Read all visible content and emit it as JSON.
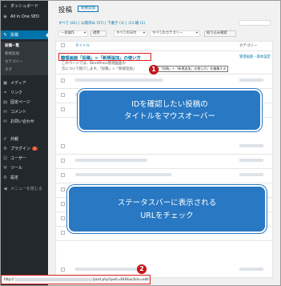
{
  "sidebar": {
    "items": [
      {
        "icon": "dashboard-icon",
        "glyph": "⌂",
        "label": "ダッシュボード"
      },
      {
        "icon": "seo-icon",
        "glyph": "◉",
        "label": "All in One SEO"
      },
      {
        "icon": "pin-icon",
        "glyph": "✎",
        "label": "投稿",
        "active": true
      },
      {
        "icon": "media-icon",
        "glyph": "▣",
        "label": "メディア"
      },
      {
        "icon": "link-icon",
        "glyph": "⚭",
        "label": "リンク"
      },
      {
        "icon": "page-icon",
        "glyph": "▤",
        "label": "固定ページ"
      },
      {
        "icon": "comment-icon",
        "glyph": "✉",
        "label": "コメント"
      },
      {
        "icon": "feedback-icon",
        "glyph": "✉",
        "label": "お問い合わせ"
      },
      {
        "icon": "appearance-icon",
        "glyph": "✐",
        "label": "外観"
      },
      {
        "icon": "plugin-icon",
        "glyph": "⚙",
        "label": "プラグイン",
        "badge": "2"
      },
      {
        "icon": "user-icon",
        "glyph": "☺",
        "label": "ユーザー"
      },
      {
        "icon": "tool-icon",
        "glyph": "⚒",
        "label": "ツール"
      },
      {
        "icon": "settings-icon",
        "glyph": "⚙",
        "label": "設定"
      },
      {
        "icon": "collapse-icon",
        "glyph": "◀",
        "label": "メニューを閉じる"
      }
    ],
    "submenu": [
      "投稿一覧",
      "新規追加",
      "カテゴリー",
      "タグ"
    ]
  },
  "header": {
    "title": "投稿",
    "add_new": "新規追加"
  },
  "status_links": "すべて (61) | 公開済み (57) | 下書き (1) | ゴミ箱 (1)",
  "filters": {
    "bulk_action": "一括操作",
    "apply": "適用",
    "date": "すべての日付",
    "category": "すべてのカテゴリー",
    "filter": "絞り込み検索"
  },
  "table": {
    "headers": {
      "title": "タイトル",
      "category": "カテゴリー"
    },
    "post": {
      "title": "管理画面「投稿」>「新規追加」の使い方",
      "category": "管理画面・基本設定",
      "excerpt_1": "このページでは、WordPress管理画面の",
      "excerpt_2": "方について紹介します。「投稿」>「新規追加」"
    },
    "tooltip": "画面「投稿」>「新規追加」の使い方」を編集する"
  },
  "callouts": {
    "first": {
      "number": "1",
      "line1": "IDを確認したい投稿の",
      "line2": "タイトルをマウスオーバー"
    },
    "second": {
      "number": "2",
      "line1": "ステータスバーに表示される",
      "line2": "URLをチェック"
    }
  },
  "statusbar": {
    "prefix": "http://",
    "suffix": "/post.php?post=646&action=edit"
  },
  "colors": {
    "sidebar": "#23282d",
    "accent": "#0073aa",
    "callout": "#2878c3",
    "marker": "#c4171b",
    "highlight": "#e02020"
  }
}
